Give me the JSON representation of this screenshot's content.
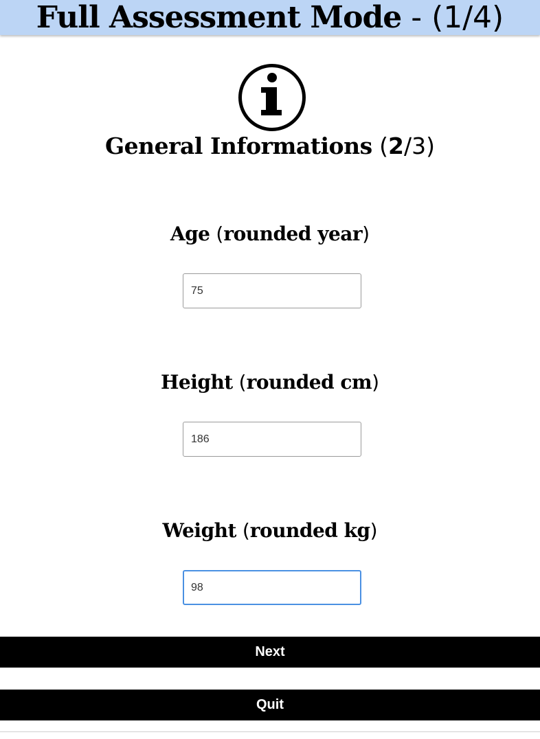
{
  "header": {
    "title": "Full Assessment Mode",
    "separator": " - ",
    "count_open": "(",
    "count_current": "1",
    "count_rest": "/4)"
  },
  "section": {
    "icon": "info-icon",
    "title": "General Informations",
    "count_open": " (",
    "count_current": "2",
    "count_rest": "/3)"
  },
  "fields": [
    {
      "label": "Age",
      "paren_open": " (",
      "unit": "rounded year",
      "paren_close": ")",
      "value": "75"
    },
    {
      "label": "Height",
      "paren_open": " (",
      "unit": "rounded cm",
      "paren_close": ")",
      "value": "186"
    },
    {
      "label": "Weight",
      "paren_open": " (",
      "unit": "rounded kg",
      "paren_close": ")",
      "value": "98"
    }
  ],
  "buttons": {
    "next": "Next",
    "quit": "Quit"
  },
  "colors": {
    "header_bg": "#bcd5f5",
    "focus_border": "#4a90e2",
    "button_bg": "#000000"
  }
}
